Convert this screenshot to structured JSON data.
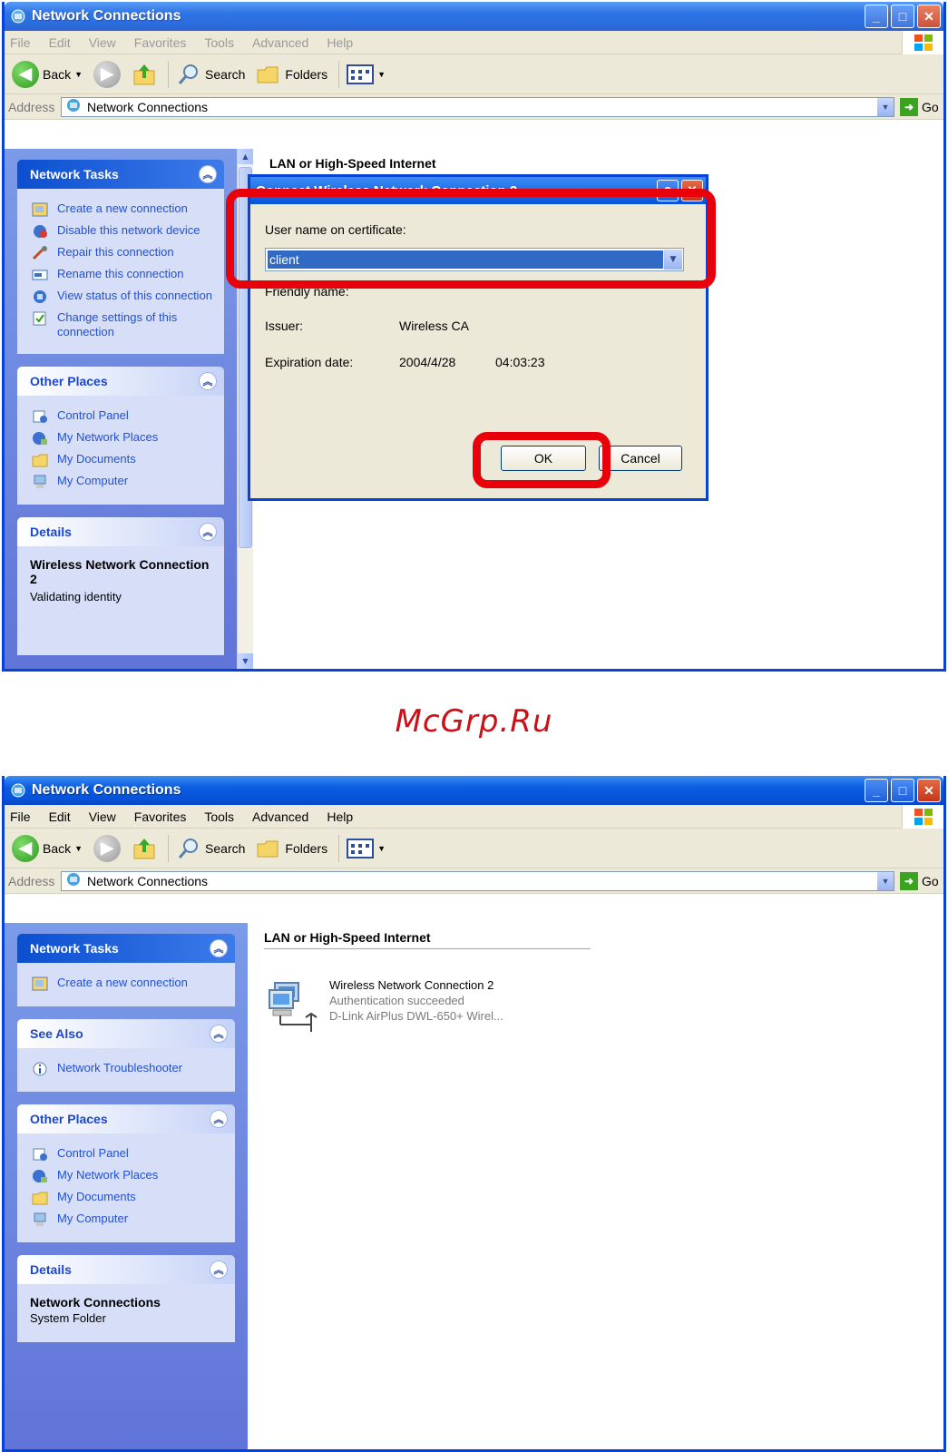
{
  "window1": {
    "title": "Network Connections",
    "menu": [
      "File",
      "Edit",
      "View",
      "Favorites",
      "Tools",
      "Advanced",
      "Help"
    ],
    "toolbar": {
      "back": "Back",
      "search": "Search",
      "folders": "Folders"
    },
    "address": {
      "label": "Address",
      "value": "Network Connections",
      "go": "Go"
    },
    "sidebar": {
      "network_tasks": {
        "title": "Network Tasks",
        "items": [
          "Create a new connection",
          "Disable this network device",
          "Repair this connection",
          "Rename this connection",
          "View status of this connection",
          "Change settings of this connection"
        ]
      },
      "other_places": {
        "title": "Other Places",
        "items": [
          "Control Panel",
          "My Network Places",
          "My Documents",
          "My Computer"
        ]
      },
      "details": {
        "title": "Details",
        "name": "Wireless Network Connection 2",
        "status": "Validating identity"
      }
    },
    "main": {
      "group": "LAN or High-Speed Internet"
    },
    "dialog": {
      "title": "Connect Wireless Network Connection 2",
      "username_label": "User name on certificate:",
      "username_value": "client",
      "friendly_label": "Friendly name:",
      "issuer_label": "Issuer:",
      "issuer_value": "Wireless CA",
      "expiration_label": "Expiration date:",
      "expiration_date": "2004/4/28",
      "expiration_time": "04:03:23",
      "ok": "OK",
      "cancel": "Cancel"
    }
  },
  "watermark": "McGrp.Ru",
  "window2": {
    "title": "Network Connections",
    "menu": [
      "File",
      "Edit",
      "View",
      "Favorites",
      "Tools",
      "Advanced",
      "Help"
    ],
    "toolbar": {
      "back": "Back",
      "search": "Search",
      "folders": "Folders"
    },
    "address": {
      "label": "Address",
      "value": "Network Connections",
      "go": "Go"
    },
    "sidebar": {
      "network_tasks": {
        "title": "Network Tasks",
        "items": [
          "Create a new connection"
        ]
      },
      "see_also": {
        "title": "See Also",
        "items": [
          "Network Troubleshooter"
        ]
      },
      "other_places": {
        "title": "Other Places",
        "items": [
          "Control Panel",
          "My Network Places",
          "My Documents",
          "My Computer"
        ]
      },
      "details": {
        "title": "Details",
        "name": "Network Connections",
        "sub": "System Folder"
      }
    },
    "main": {
      "group": "LAN or High-Speed Internet",
      "connection": {
        "name": "Wireless Network Connection 2",
        "status": "Authentication succeeded",
        "device": "D-Link AirPlus DWL-650+ Wirel..."
      }
    }
  },
  "colors": {
    "highlight": "#e8000b",
    "title_blue": "#0653d8",
    "link_blue": "#2150d4"
  }
}
